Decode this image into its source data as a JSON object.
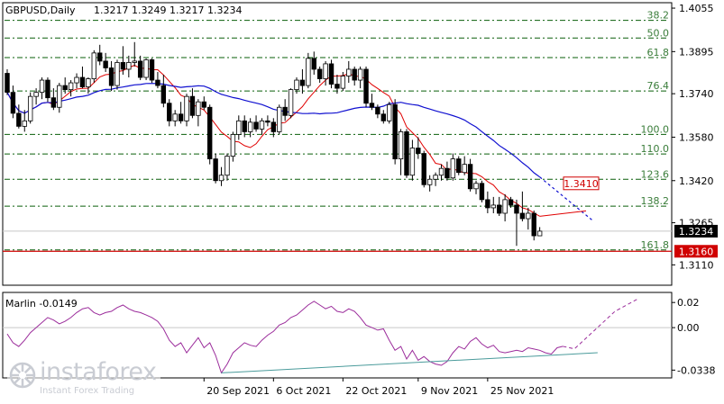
{
  "header": {
    "symbol": "GBPUSD,Daily",
    "ohlc": "1.3217 1.3249 1.3217 1.3234"
  },
  "colors": {
    "bull": "#000000",
    "bear": "#000000",
    "ma_fast": "#e00000",
    "ma_slow": "#1010d0",
    "fib_lines": "#0a5f0a",
    "fib_labels": "#3a7d3a",
    "support": "#d00000",
    "oscillator": "#9b2c9b",
    "trendline": "#4a9b9b"
  },
  "chart_data": [
    {
      "type": "candlestick",
      "title": "GBPUSD,Daily",
      "ylim": [
        1.3035,
        1.4075
      ],
      "y_ticks": [
        "1.4055",
        "1.3895",
        "1.3740",
        "1.3580",
        "1.3420",
        "1.3265",
        "1.3110"
      ],
      "x_ticks": [
        "20 Sep 2021",
        "6 Oct 2021",
        "22 Oct 2021",
        "9 Nov 2021",
        "25 Nov 2021"
      ],
      "current_price": "1.3234",
      "fibonacci_levels": [
        {
          "label": "38.2",
          "value": 1.401
        },
        {
          "label": "50.0",
          "value": 1.3945
        },
        {
          "label": "61.8",
          "value": 1.3873
        },
        {
          "label": "76.4",
          "value": 1.375
        },
        {
          "label": "100.0",
          "value": 1.359
        },
        {
          "label": "110.0",
          "value": 1.3518
        },
        {
          "label": "123.6",
          "value": 1.3425
        },
        {
          "label": "138.2",
          "value": 1.3326
        },
        {
          "label": "161.8",
          "value": 1.3165
        }
      ],
      "support_level": {
        "label": "1.3160",
        "value": 1.316
      },
      "ma_annotation": "1.3410",
      "candles": [
        [
          1.3815,
          1.383,
          1.3735,
          1.3745
        ],
        [
          1.3745,
          1.377,
          1.365,
          1.3668
        ],
        [
          1.3668,
          1.37,
          1.3612,
          1.362
        ],
        [
          1.362,
          1.368,
          1.36,
          1.364
        ],
        [
          1.364,
          1.3745,
          1.363,
          1.373
        ],
        [
          1.373,
          1.376,
          1.37,
          1.3745
        ],
        [
          1.3745,
          1.38,
          1.372,
          1.379
        ],
        [
          1.379,
          1.38,
          1.371,
          1.3725
        ],
        [
          1.3725,
          1.376,
          1.368,
          1.369
        ],
        [
          1.369,
          1.378,
          1.367,
          1.377
        ],
        [
          1.377,
          1.38,
          1.374,
          1.3755
        ],
        [
          1.3755,
          1.379,
          1.373,
          1.378
        ],
        [
          1.378,
          1.3815,
          1.376,
          1.38
        ],
        [
          1.38,
          1.384,
          1.376,
          1.3765
        ],
        [
          1.3765,
          1.38,
          1.374,
          1.3795
        ],
        [
          1.3795,
          1.39,
          1.378,
          1.389
        ],
        [
          1.389,
          1.392,
          1.3845,
          1.386
        ],
        [
          1.386,
          1.389,
          1.382,
          1.3835
        ],
        [
          1.3835,
          1.386,
          1.375,
          1.377
        ],
        [
          1.377,
          1.3865,
          1.3755,
          1.3855
        ],
        [
          1.3855,
          1.3915,
          1.381,
          1.383
        ],
        [
          1.383,
          1.388,
          1.38,
          1.3855
        ],
        [
          1.3855,
          1.393,
          1.384,
          1.386
        ],
        [
          1.386,
          1.388,
          1.379,
          1.38
        ],
        [
          1.38,
          1.387,
          1.379,
          1.3865
        ],
        [
          1.3865,
          1.387,
          1.378,
          1.379
        ],
        [
          1.379,
          1.382,
          1.376,
          1.377
        ],
        [
          1.377,
          1.381,
          1.369,
          1.3705
        ],
        [
          1.3705,
          1.372,
          1.362,
          1.364
        ],
        [
          1.364,
          1.368,
          1.362,
          1.3665
        ],
        [
          1.3665,
          1.371,
          1.363,
          1.364
        ],
        [
          1.364,
          1.374,
          1.362,
          1.373
        ],
        [
          1.373,
          1.376,
          1.365,
          1.366
        ],
        [
          1.366,
          1.372,
          1.362,
          1.371
        ],
        [
          1.371,
          1.373,
          1.368,
          1.369
        ],
        [
          1.369,
          1.37,
          1.348,
          1.35
        ],
        [
          1.35,
          1.352,
          1.341,
          1.342
        ],
        [
          1.342,
          1.347,
          1.34,
          1.344
        ],
        [
          1.344,
          1.352,
          1.342,
          1.351
        ],
        [
          1.351,
          1.36,
          1.349,
          1.359
        ],
        [
          1.359,
          1.366,
          1.357,
          1.364
        ],
        [
          1.364,
          1.366,
          1.358,
          1.36
        ],
        [
          1.36,
          1.365,
          1.358,
          1.3635
        ],
        [
          1.3635,
          1.366,
          1.36,
          1.361
        ],
        [
          1.361,
          1.365,
          1.359,
          1.364
        ],
        [
          1.364,
          1.366,
          1.362,
          1.3635
        ],
        [
          1.3635,
          1.365,
          1.358,
          1.36
        ],
        [
          1.36,
          1.37,
          1.359,
          1.369
        ],
        [
          1.369,
          1.372,
          1.364,
          1.366
        ],
        [
          1.366,
          1.376,
          1.365,
          1.3755
        ],
        [
          1.3755,
          1.38,
          1.374,
          1.379
        ],
        [
          1.379,
          1.383,
          1.374,
          1.377
        ],
        [
          1.377,
          1.389,
          1.376,
          1.387
        ],
        [
          1.387,
          1.3895,
          1.381,
          1.383
        ],
        [
          1.383,
          1.384,
          1.378,
          1.3795
        ],
        [
          1.3795,
          1.386,
          1.377,
          1.385
        ],
        [
          1.385,
          1.3865,
          1.376,
          1.3775
        ],
        [
          1.3775,
          1.381,
          1.374,
          1.376
        ],
        [
          1.376,
          1.382,
          1.375,
          1.3805
        ],
        [
          1.3805,
          1.386,
          1.378,
          1.383
        ],
        [
          1.383,
          1.384,
          1.377,
          1.379
        ],
        [
          1.379,
          1.384,
          1.376,
          1.383
        ],
        [
          1.383,
          1.384,
          1.369,
          1.3705
        ],
        [
          1.3705,
          1.374,
          1.368,
          1.369
        ],
        [
          1.369,
          1.37,
          1.365,
          1.3665
        ],
        [
          1.3665,
          1.368,
          1.363,
          1.364
        ],
        [
          1.364,
          1.371,
          1.363,
          1.37
        ],
        [
          1.37,
          1.372,
          1.348,
          1.35
        ],
        [
          1.35,
          1.361,
          1.344,
          1.36
        ],
        [
          1.36,
          1.361,
          1.343,
          1.344
        ],
        [
          1.344,
          1.357,
          1.342,
          1.354
        ],
        [
          1.354,
          1.358,
          1.35,
          1.352
        ],
        [
          1.352,
          1.353,
          1.3395,
          1.3405
        ],
        [
          1.3405,
          1.344,
          1.338,
          1.3425
        ],
        [
          1.3425,
          1.345,
          1.34,
          1.344
        ],
        [
          1.344,
          1.348,
          1.342,
          1.3465
        ],
        [
          1.3465,
          1.349,
          1.342,
          1.343
        ],
        [
          1.343,
          1.352,
          1.342,
          1.35
        ],
        [
          1.35,
          1.351,
          1.344,
          1.345
        ],
        [
          1.345,
          1.351,
          1.344,
          1.348
        ],
        [
          1.348,
          1.35,
          1.338,
          1.339
        ],
        [
          1.339,
          1.342,
          1.337,
          1.341
        ],
        [
          1.341,
          1.342,
          1.334,
          1.335
        ],
        [
          1.335,
          1.338,
          1.33,
          1.332
        ],
        [
          1.332,
          1.336,
          1.33,
          1.333
        ],
        [
          1.333,
          1.336,
          1.329,
          1.33
        ],
        [
          1.33,
          1.337,
          1.327,
          1.335
        ],
        [
          1.335,
          1.336,
          1.332,
          1.333
        ],
        [
          1.333,
          1.335,
          1.318,
          1.33
        ],
        [
          1.33,
          1.338,
          1.327,
          1.328
        ],
        [
          1.328,
          1.332,
          1.324,
          1.33
        ],
        [
          1.33,
          1.331,
          1.32,
          1.3217
        ],
        [
          1.3217,
          1.3249,
          1.3217,
          1.3234
        ]
      ]
    },
    {
      "type": "line",
      "title": "Marlin -0.0149",
      "ylim": [
        -0.04,
        0.028
      ],
      "y_ticks": [
        "0.02",
        "0.00",
        "-0.0338"
      ],
      "values": [
        -0.005,
        -0.012,
        -0.015,
        -0.01,
        -0.004,
        0.0,
        0.004,
        0.008,
        0.006,
        0.003,
        0.005,
        0.008,
        0.012,
        0.015,
        0.016,
        0.012,
        0.01,
        0.012,
        0.013,
        0.016,
        0.018,
        0.015,
        0.013,
        0.012,
        0.01,
        0.008,
        0.005,
        -0.001,
        -0.01,
        -0.015,
        -0.012,
        -0.02,
        -0.014,
        -0.008,
        -0.016,
        -0.012,
        -0.022,
        -0.036,
        -0.029,
        -0.02,
        -0.016,
        -0.012,
        -0.014,
        -0.015,
        -0.01,
        -0.006,
        -0.003,
        0.002,
        0.004,
        0.008,
        0.01,
        0.014,
        0.018,
        0.021,
        0.018,
        0.015,
        0.017,
        0.013,
        0.012,
        0.015,
        0.013,
        0.008,
        0.002,
        0.0,
        -0.002,
        -0.001,
        -0.01,
        -0.018,
        -0.015,
        -0.025,
        -0.018,
        -0.026,
        -0.023,
        -0.027,
        -0.029,
        -0.03,
        -0.027,
        -0.02,
        -0.015,
        -0.017,
        -0.011,
        -0.008,
        -0.013,
        -0.016,
        -0.014,
        -0.019,
        -0.02,
        -0.019,
        -0.018,
        -0.019,
        -0.016,
        -0.017,
        -0.018,
        -0.02,
        -0.021,
        -0.016,
        -0.0149
      ],
      "projection": [
        -0.0149,
        0.013,
        0.023
      ],
      "trendline": [
        -0.036,
        -0.02
      ]
    }
  ],
  "watermark": {
    "brand": "instaforex",
    "tag": "Instant Forex Trading"
  },
  "icons": {
    "watermark_logo": "instaforex-logo-icon"
  }
}
